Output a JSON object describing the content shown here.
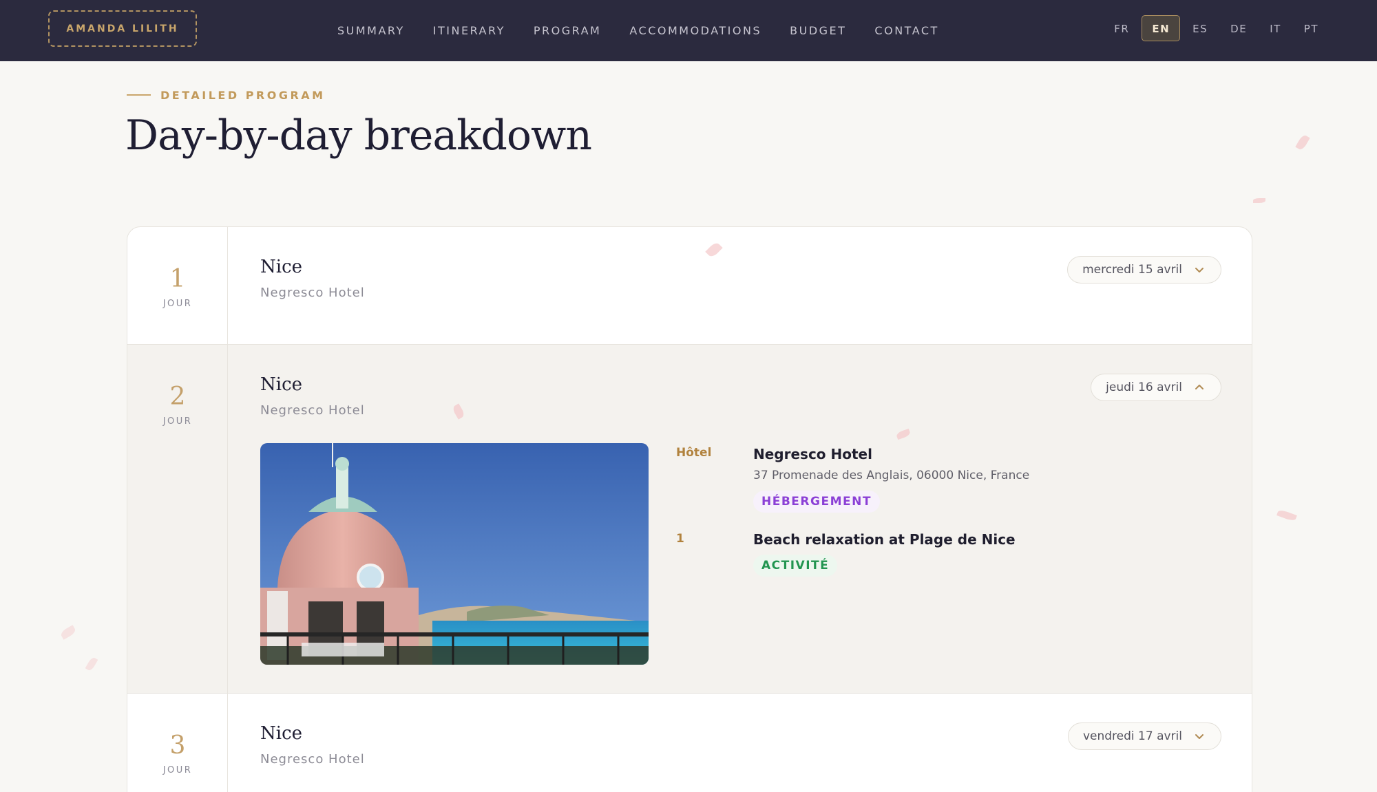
{
  "brand": {
    "logo": "AMANDA LILITH"
  },
  "nav": {
    "links": [
      "SUMMARY",
      "ITINERARY",
      "PROGRAM",
      "ACCOMMODATIONS",
      "BUDGET",
      "CONTACT"
    ],
    "languages": [
      "FR",
      "EN",
      "ES",
      "DE",
      "IT",
      "PT"
    ],
    "active_language": "EN"
  },
  "header": {
    "eyebrow": "DETAILED PROGRAM",
    "title": "Day-by-day breakdown"
  },
  "days": [
    {
      "number": "1",
      "day_label": "JOUR",
      "city": "Nice",
      "hotel": "Negresco Hotel",
      "date": "mercredi 15 avril",
      "expanded": false
    },
    {
      "number": "2",
      "day_label": "JOUR",
      "city": "Nice",
      "hotel": "Negresco Hotel",
      "date": "jeudi 16 avril",
      "expanded": true,
      "details": [
        {
          "label": "Hôtel",
          "title": "Negresco Hotel",
          "address": "37 Promenade des Anglais, 06000 Nice, France",
          "badge": "HÉBERGEMENT"
        },
        {
          "label": "1",
          "title": "Beach relaxation at Plage de Nice",
          "badge": "ACTIVITÉ"
        }
      ]
    },
    {
      "number": "3",
      "day_label": "JOUR",
      "city": "Nice",
      "hotel": "Negresco Hotel",
      "date": "vendredi 17 avril",
      "expanded": false
    }
  ],
  "colors": {
    "nav_bg": "#2b2a3e",
    "accent_gold": "#c9a66b",
    "badge_accommodation": "#8b3fd6",
    "badge_activity": "#229550"
  }
}
